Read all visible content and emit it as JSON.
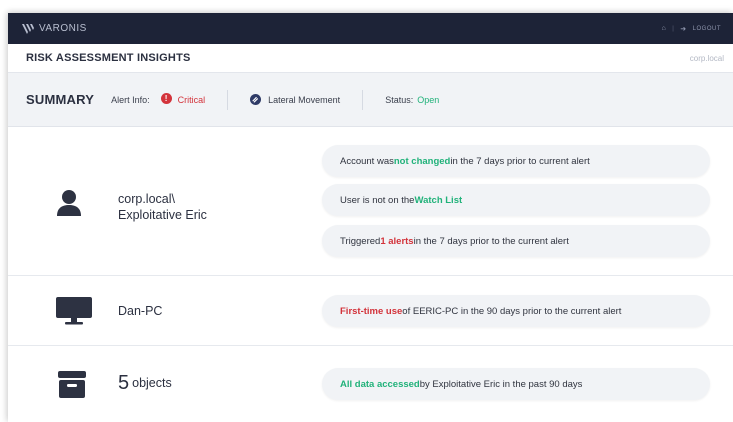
{
  "header": {
    "brand": "VARONIS",
    "logout_label": "LOGOUT"
  },
  "titlebar": {
    "title": "RISK ASSESSMENT INSIGHTS",
    "domain": "corp.local"
  },
  "summary": {
    "title": "SUMMARY",
    "alert_info_label": "Alert Info:",
    "severity": "Critical",
    "threat_model": "Lateral Movement",
    "status_label": "Status:",
    "status_value": "Open"
  },
  "entities": {
    "user": {
      "domain": "corp.local\\",
      "name": "Exploitative Eric",
      "insights": [
        {
          "pre": "Account was ",
          "hl": "not changed",
          "post": " in the 7 days prior to current alert"
        },
        {
          "pre": "User is not on the ",
          "hl": "Watch List",
          "post": ""
        },
        {
          "pre": "Triggered ",
          "hl": "1 alerts",
          "post": " in the 7 days prior to the current alert"
        }
      ]
    },
    "device": {
      "name": "Dan-PC",
      "insight": {
        "pre": "",
        "hl": "First-time use",
        "post": " of EERIC-PC in the 90 days prior to the current alert"
      }
    },
    "data": {
      "count": "5",
      "unit": "objects",
      "insight": {
        "pre": "",
        "hl": "All data accessed",
        "post": " by Exploitative Eric in the past 90 days"
      }
    }
  },
  "colors": {
    "topbar": "#1d2337",
    "critical": "#d3333b",
    "positive": "#21b27a",
    "summary_bg": "#f1f3f6"
  },
  "icons": {
    "brand": "varonis-logo-icon",
    "home": "home-icon",
    "logout": "logout-icon",
    "alert": "exclamation-icon",
    "threat": "link-icon",
    "user": "user-icon",
    "device": "monitor-icon",
    "data": "archive-box-icon"
  }
}
